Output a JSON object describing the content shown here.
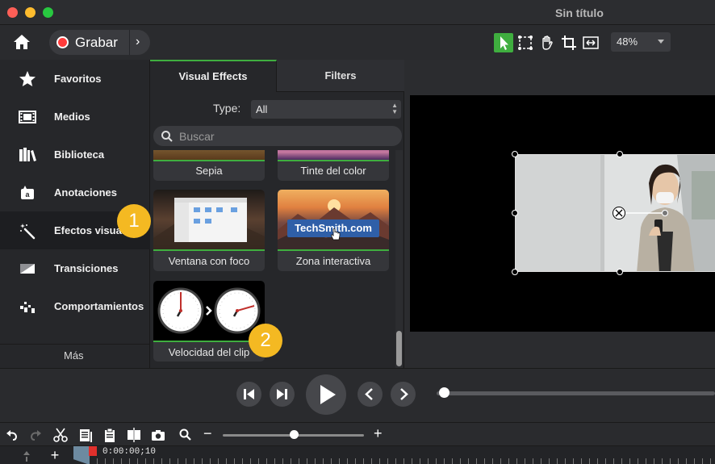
{
  "window": {
    "title": "Sin título"
  },
  "toolbar": {
    "record_label": "Grabar",
    "zoom_value": "48%",
    "tools": [
      "pointer-icon",
      "crop-select-icon",
      "hand-icon",
      "crop-icon",
      "fit-icon"
    ]
  },
  "nav": {
    "items": [
      {
        "label": "Favoritos",
        "icon": "star-icon"
      },
      {
        "label": "Medios",
        "icon": "film-icon"
      },
      {
        "label": "Biblioteca",
        "icon": "library-icon"
      },
      {
        "label": "Anotaciones",
        "icon": "annotation-icon"
      },
      {
        "label": "Efectos visuales",
        "icon": "magic-wand-icon"
      },
      {
        "label": "Transiciones",
        "icon": "transition-icon"
      },
      {
        "label": "Comportamientos",
        "icon": "behaviors-icon"
      }
    ],
    "more_label": "Más"
  },
  "library": {
    "tabs": [
      "Visual Effects",
      "Filters"
    ],
    "type_label": "Type:",
    "type_value": "All",
    "search_placeholder": "Buscar",
    "cards": [
      {
        "label": "Sepia"
      },
      {
        "label": "Tinte del color"
      },
      {
        "label": "Ventana con foco"
      },
      {
        "label": "Zona interactiva",
        "overlay_text": "TechSmith.com"
      },
      {
        "label": "Velocidad del clip"
      }
    ]
  },
  "badges": [
    "1",
    "2"
  ],
  "timeline": {
    "timecode": "0:00:00;10"
  },
  "colors": {
    "accent": "#3fae3f",
    "record": "#ff3b3b",
    "badge": "#f4b922"
  }
}
